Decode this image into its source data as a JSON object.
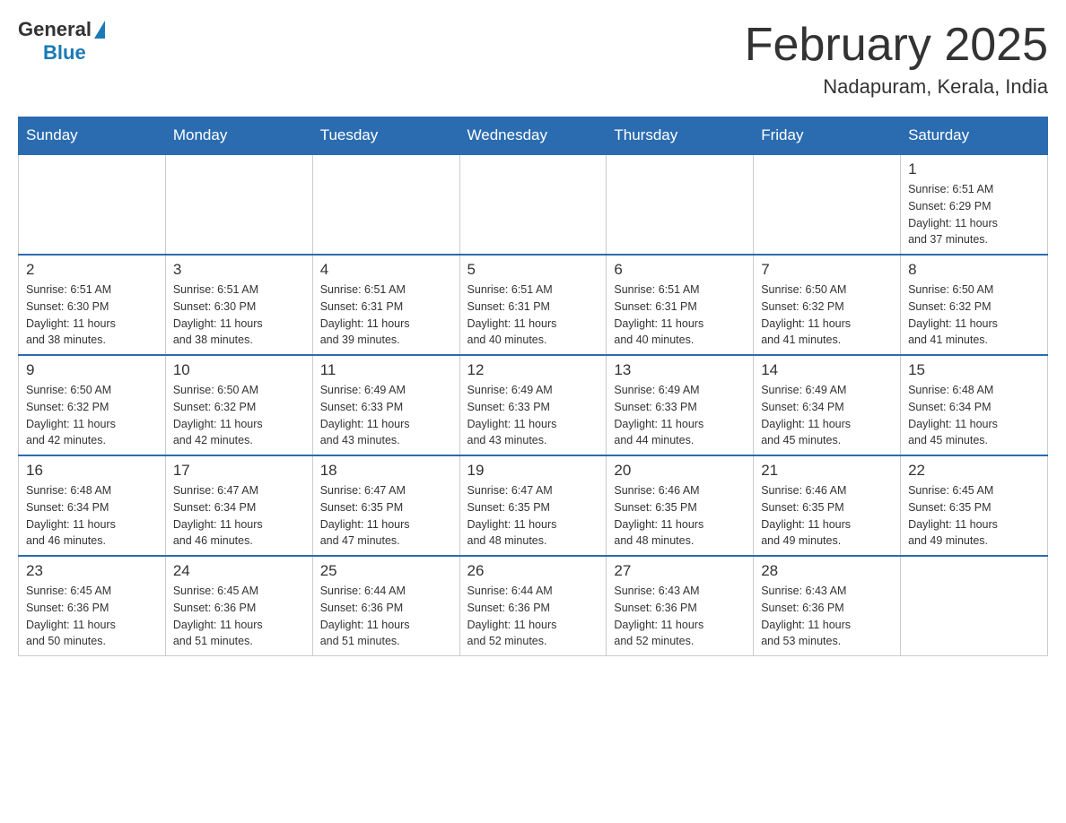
{
  "header": {
    "logo_general": "General",
    "logo_blue": "Blue",
    "title": "February 2025",
    "location": "Nadapuram, Kerala, India"
  },
  "days_of_week": [
    "Sunday",
    "Monday",
    "Tuesday",
    "Wednesday",
    "Thursday",
    "Friday",
    "Saturday"
  ],
  "weeks": [
    [
      {
        "day": "",
        "info": ""
      },
      {
        "day": "",
        "info": ""
      },
      {
        "day": "",
        "info": ""
      },
      {
        "day": "",
        "info": ""
      },
      {
        "day": "",
        "info": ""
      },
      {
        "day": "",
        "info": ""
      },
      {
        "day": "1",
        "info": "Sunrise: 6:51 AM\nSunset: 6:29 PM\nDaylight: 11 hours\nand 37 minutes."
      }
    ],
    [
      {
        "day": "2",
        "info": "Sunrise: 6:51 AM\nSunset: 6:30 PM\nDaylight: 11 hours\nand 38 minutes."
      },
      {
        "day": "3",
        "info": "Sunrise: 6:51 AM\nSunset: 6:30 PM\nDaylight: 11 hours\nand 38 minutes."
      },
      {
        "day": "4",
        "info": "Sunrise: 6:51 AM\nSunset: 6:31 PM\nDaylight: 11 hours\nand 39 minutes."
      },
      {
        "day": "5",
        "info": "Sunrise: 6:51 AM\nSunset: 6:31 PM\nDaylight: 11 hours\nand 40 minutes."
      },
      {
        "day": "6",
        "info": "Sunrise: 6:51 AM\nSunset: 6:31 PM\nDaylight: 11 hours\nand 40 minutes."
      },
      {
        "day": "7",
        "info": "Sunrise: 6:50 AM\nSunset: 6:32 PM\nDaylight: 11 hours\nand 41 minutes."
      },
      {
        "day": "8",
        "info": "Sunrise: 6:50 AM\nSunset: 6:32 PM\nDaylight: 11 hours\nand 41 minutes."
      }
    ],
    [
      {
        "day": "9",
        "info": "Sunrise: 6:50 AM\nSunset: 6:32 PM\nDaylight: 11 hours\nand 42 minutes."
      },
      {
        "day": "10",
        "info": "Sunrise: 6:50 AM\nSunset: 6:32 PM\nDaylight: 11 hours\nand 42 minutes."
      },
      {
        "day": "11",
        "info": "Sunrise: 6:49 AM\nSunset: 6:33 PM\nDaylight: 11 hours\nand 43 minutes."
      },
      {
        "day": "12",
        "info": "Sunrise: 6:49 AM\nSunset: 6:33 PM\nDaylight: 11 hours\nand 43 minutes."
      },
      {
        "day": "13",
        "info": "Sunrise: 6:49 AM\nSunset: 6:33 PM\nDaylight: 11 hours\nand 44 minutes."
      },
      {
        "day": "14",
        "info": "Sunrise: 6:49 AM\nSunset: 6:34 PM\nDaylight: 11 hours\nand 45 minutes."
      },
      {
        "day": "15",
        "info": "Sunrise: 6:48 AM\nSunset: 6:34 PM\nDaylight: 11 hours\nand 45 minutes."
      }
    ],
    [
      {
        "day": "16",
        "info": "Sunrise: 6:48 AM\nSunset: 6:34 PM\nDaylight: 11 hours\nand 46 minutes."
      },
      {
        "day": "17",
        "info": "Sunrise: 6:47 AM\nSunset: 6:34 PM\nDaylight: 11 hours\nand 46 minutes."
      },
      {
        "day": "18",
        "info": "Sunrise: 6:47 AM\nSunset: 6:35 PM\nDaylight: 11 hours\nand 47 minutes."
      },
      {
        "day": "19",
        "info": "Sunrise: 6:47 AM\nSunset: 6:35 PM\nDaylight: 11 hours\nand 48 minutes."
      },
      {
        "day": "20",
        "info": "Sunrise: 6:46 AM\nSunset: 6:35 PM\nDaylight: 11 hours\nand 48 minutes."
      },
      {
        "day": "21",
        "info": "Sunrise: 6:46 AM\nSunset: 6:35 PM\nDaylight: 11 hours\nand 49 minutes."
      },
      {
        "day": "22",
        "info": "Sunrise: 6:45 AM\nSunset: 6:35 PM\nDaylight: 11 hours\nand 49 minutes."
      }
    ],
    [
      {
        "day": "23",
        "info": "Sunrise: 6:45 AM\nSunset: 6:36 PM\nDaylight: 11 hours\nand 50 minutes."
      },
      {
        "day": "24",
        "info": "Sunrise: 6:45 AM\nSunset: 6:36 PM\nDaylight: 11 hours\nand 51 minutes."
      },
      {
        "day": "25",
        "info": "Sunrise: 6:44 AM\nSunset: 6:36 PM\nDaylight: 11 hours\nand 51 minutes."
      },
      {
        "day": "26",
        "info": "Sunrise: 6:44 AM\nSunset: 6:36 PM\nDaylight: 11 hours\nand 52 minutes."
      },
      {
        "day": "27",
        "info": "Sunrise: 6:43 AM\nSunset: 6:36 PM\nDaylight: 11 hours\nand 52 minutes."
      },
      {
        "day": "28",
        "info": "Sunrise: 6:43 AM\nSunset: 6:36 PM\nDaylight: 11 hours\nand 53 minutes."
      },
      {
        "day": "",
        "info": ""
      }
    ]
  ]
}
